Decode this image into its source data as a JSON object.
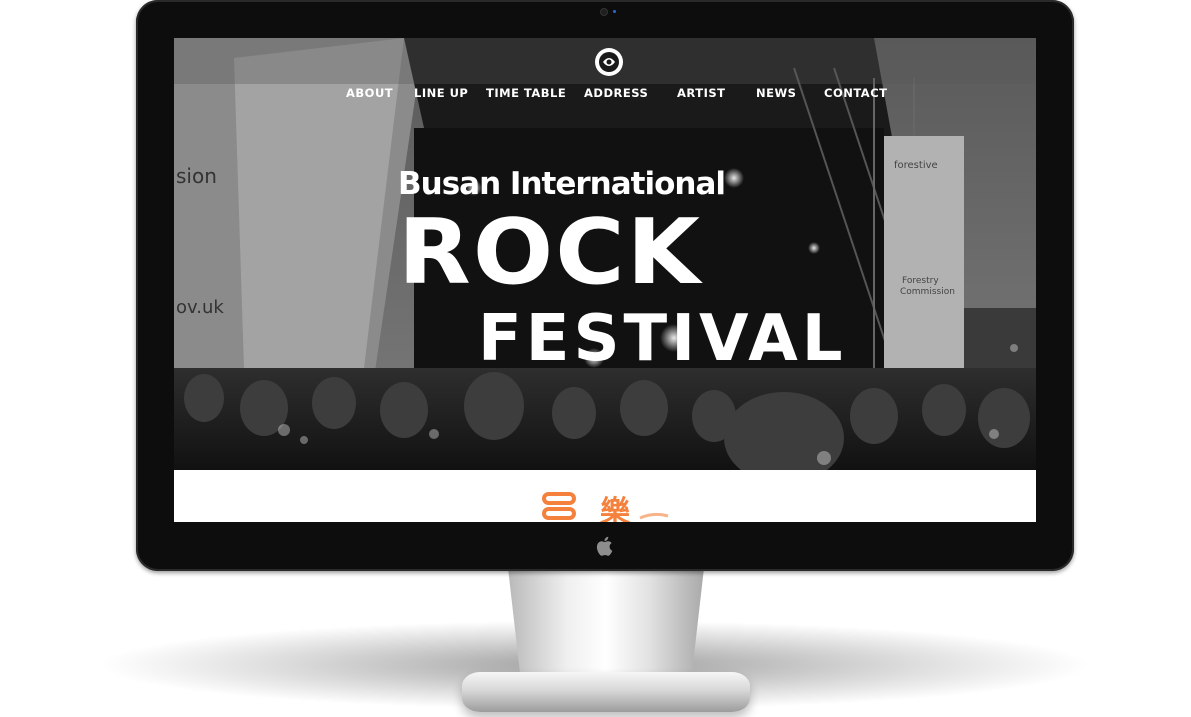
{
  "site": {
    "logo_icon": "festival-logo-icon",
    "nav": [
      {
        "label": "ABOUT"
      },
      {
        "label": "LINE UP"
      },
      {
        "label": "TIME TABLE"
      },
      {
        "label": "ADDRESS"
      },
      {
        "label": "ARTIST"
      },
      {
        "label": "NEWS"
      },
      {
        "label": "CONTACT"
      }
    ],
    "hero": {
      "line1": "Busan International",
      "line2": "ROCK",
      "line3": "FESTIVAL"
    },
    "section": {
      "badge_text": "樂",
      "badge_color": "#f4813c"
    }
  },
  "device": {
    "brand_icon": "apple-icon"
  },
  "colors": {
    "bezel": "#0d0d0d",
    "accent_orange": "#f4813c",
    "nav_text": "#ffffff"
  }
}
